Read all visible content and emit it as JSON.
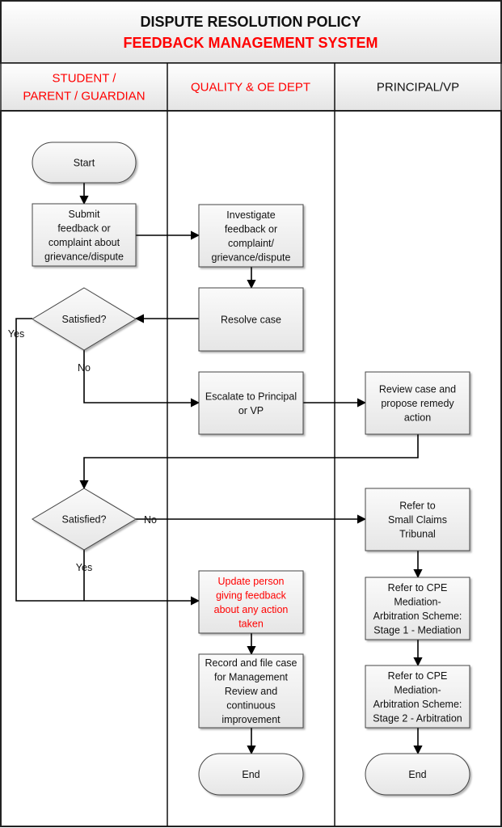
{
  "title": "DISPUTE RESOLUTION POLICY",
  "subtitle": "FEEDBACK MANAGEMENT SYSTEM",
  "lanes": [
    {
      "label_lines": [
        "STUDENT /",
        "PARENT / GUARDIAN"
      ],
      "color": "#ff0000"
    },
    {
      "label_lines": [
        "QUALITY & OE DEPT"
      ],
      "color": "#ff0000"
    },
    {
      "label_lines": [
        "PRINCIPAL/VP"
      ],
      "color": "#111111"
    }
  ],
  "nodes": {
    "start": {
      "type": "terminator",
      "lines": [
        "Start"
      ]
    },
    "submit": {
      "type": "process",
      "lines": [
        "Submit",
        "feedback or",
        "complaint about",
        "grievance/dispute"
      ]
    },
    "investigate": {
      "type": "process",
      "lines": [
        "Investigate",
        "feedback or",
        "complaint/",
        "grievance/dispute"
      ]
    },
    "resolve": {
      "type": "process",
      "lines": [
        "Resolve case"
      ]
    },
    "satisfied1": {
      "type": "decision",
      "lines": [
        "Satisfied?"
      ]
    },
    "escalate": {
      "type": "process",
      "lines": [
        "Escalate to Principal",
        "or VP"
      ]
    },
    "review": {
      "type": "process",
      "lines": [
        "Review case and",
        "propose remedy",
        "action"
      ]
    },
    "satisfied2": {
      "type": "decision",
      "lines": [
        "Satisfied?"
      ]
    },
    "small_claims": {
      "type": "process",
      "lines": [
        "Refer to",
        "Small Claims",
        "Tribunal"
      ]
    },
    "cpe1": {
      "type": "process",
      "lines": [
        "Refer to CPE",
        "Mediation-",
        "Arbitration Scheme:",
        "Stage 1 - Mediation"
      ]
    },
    "cpe2": {
      "type": "process",
      "lines": [
        "Refer to CPE",
        "Mediation-",
        "Arbitration Scheme:",
        "Stage 2 - Arbitration"
      ]
    },
    "update": {
      "type": "process",
      "lines": [
        "Update person",
        "giving feedback",
        "about any action",
        "taken"
      ],
      "color": "#ff0000"
    },
    "record": {
      "type": "process",
      "lines": [
        "Record and file case",
        "for Management",
        "Review and",
        "continuous",
        "improvement"
      ]
    },
    "end1": {
      "type": "terminator",
      "lines": [
        "End"
      ]
    },
    "end2": {
      "type": "terminator",
      "lines": [
        "End"
      ]
    }
  },
  "edge_labels": {
    "yes1": "Yes",
    "no1": "No",
    "no2": "No",
    "yes2": "Yes"
  },
  "colors": {
    "accent_red": "#ff0000",
    "shape_fill": "#eeeeee",
    "border": "#222222"
  }
}
